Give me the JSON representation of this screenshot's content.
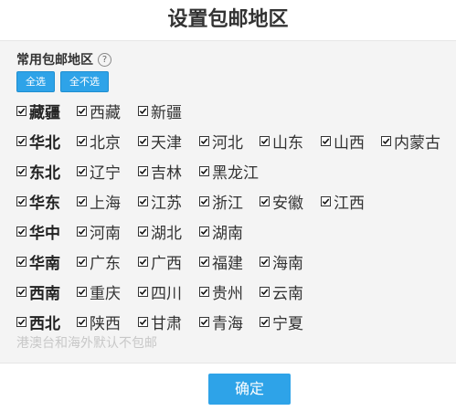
{
  "dialog": {
    "title": "设置包邮地区"
  },
  "section": {
    "heading": "常用包邮地区",
    "help_icon": "question-circle-icon"
  },
  "actions": {
    "select_all": "全选",
    "select_none": "全不选"
  },
  "groups": [
    {
      "region": "藏疆",
      "items": [
        "西藏",
        "新疆"
      ]
    },
    {
      "region": "华北",
      "items": [
        "北京",
        "天津",
        "河北",
        "山东",
        "山西",
        "内蒙古"
      ]
    },
    {
      "region": "东北",
      "items": [
        "辽宁",
        "吉林",
        "黑龙江"
      ]
    },
    {
      "region": "华东",
      "items": [
        "上海",
        "江苏",
        "浙江",
        "安徽",
        "江西"
      ]
    },
    {
      "region": "华中",
      "items": [
        "河南",
        "湖北",
        "湖南"
      ]
    },
    {
      "region": "华南",
      "items": [
        "广东",
        "广西",
        "福建",
        "海南"
      ]
    },
    {
      "region": "西南",
      "items": [
        "重庆",
        "四川",
        "贵州",
        "云南"
      ]
    },
    {
      "region": "西北",
      "items": [
        "陕西",
        "甘肃",
        "青海",
        "宁夏"
      ]
    }
  ],
  "footer_note": "港澳台和海外默认不包邮",
  "confirm_label": "确定",
  "colors": {
    "accent": "#2ea3e8",
    "panel_bg": "#f4f4f4",
    "note": "#c8c8c8"
  }
}
